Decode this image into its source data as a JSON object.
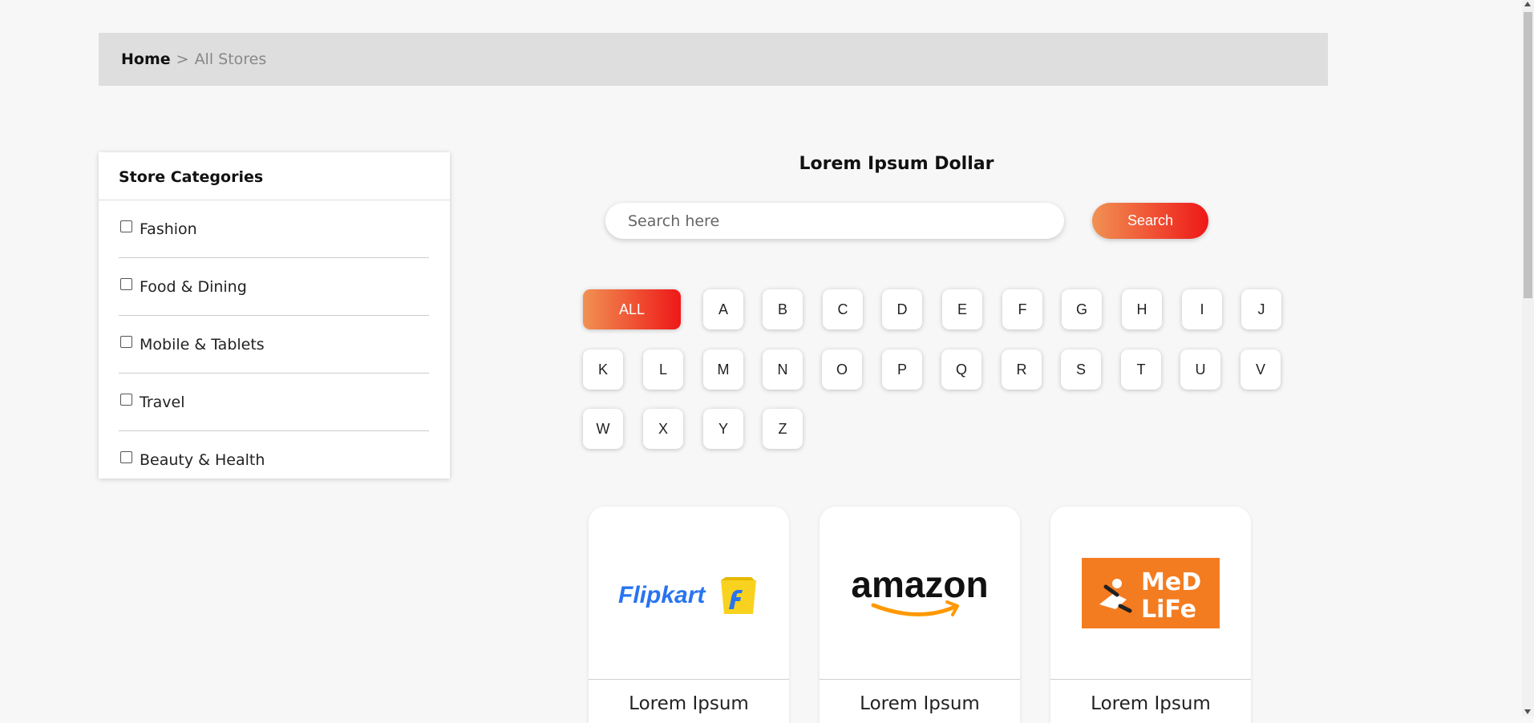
{
  "breadcrumb": {
    "home": "Home",
    "separator": ">",
    "current": "All Stores"
  },
  "sidebar": {
    "title": "Store Categories",
    "categories": [
      {
        "label": "Fashion",
        "checked": false
      },
      {
        "label": "Food & Dining",
        "checked": false
      },
      {
        "label": "Mobile & Tablets",
        "checked": false
      },
      {
        "label": "Travel",
        "checked": false
      },
      {
        "label": "Beauty & Health",
        "checked": false
      }
    ]
  },
  "main": {
    "title": "Lorem Ipsum Dollar",
    "search": {
      "placeholder": "Search here",
      "value": "",
      "button_label": "Search"
    },
    "filter": {
      "all_label": "ALL",
      "letters": [
        "A",
        "B",
        "C",
        "D",
        "E",
        "F",
        "G",
        "H",
        "I",
        "J",
        "K",
        "L",
        "M",
        "N",
        "O",
        "P",
        "Q",
        "R",
        "S",
        "T",
        "U",
        "V",
        "W",
        "X",
        "Y",
        "Z"
      ]
    },
    "stores": [
      {
        "logo": "flipkart-logo",
        "logo_text": "Flipkart",
        "name": "Lorem Ipsum"
      },
      {
        "logo": "amazon-logo",
        "logo_text": "amazon",
        "name": "Lorem Ipsum"
      },
      {
        "logo": "medlife-logo",
        "logo_text": "MeD LiFe",
        "name": "Lorem Ipsum"
      }
    ]
  },
  "colors": {
    "accent_start": "#f19152",
    "accent_end": "#ee1818",
    "flipkart_blue": "#2874f0",
    "flipkart_yellow": "#f8d21e",
    "medlife_orange": "#f47c20"
  }
}
